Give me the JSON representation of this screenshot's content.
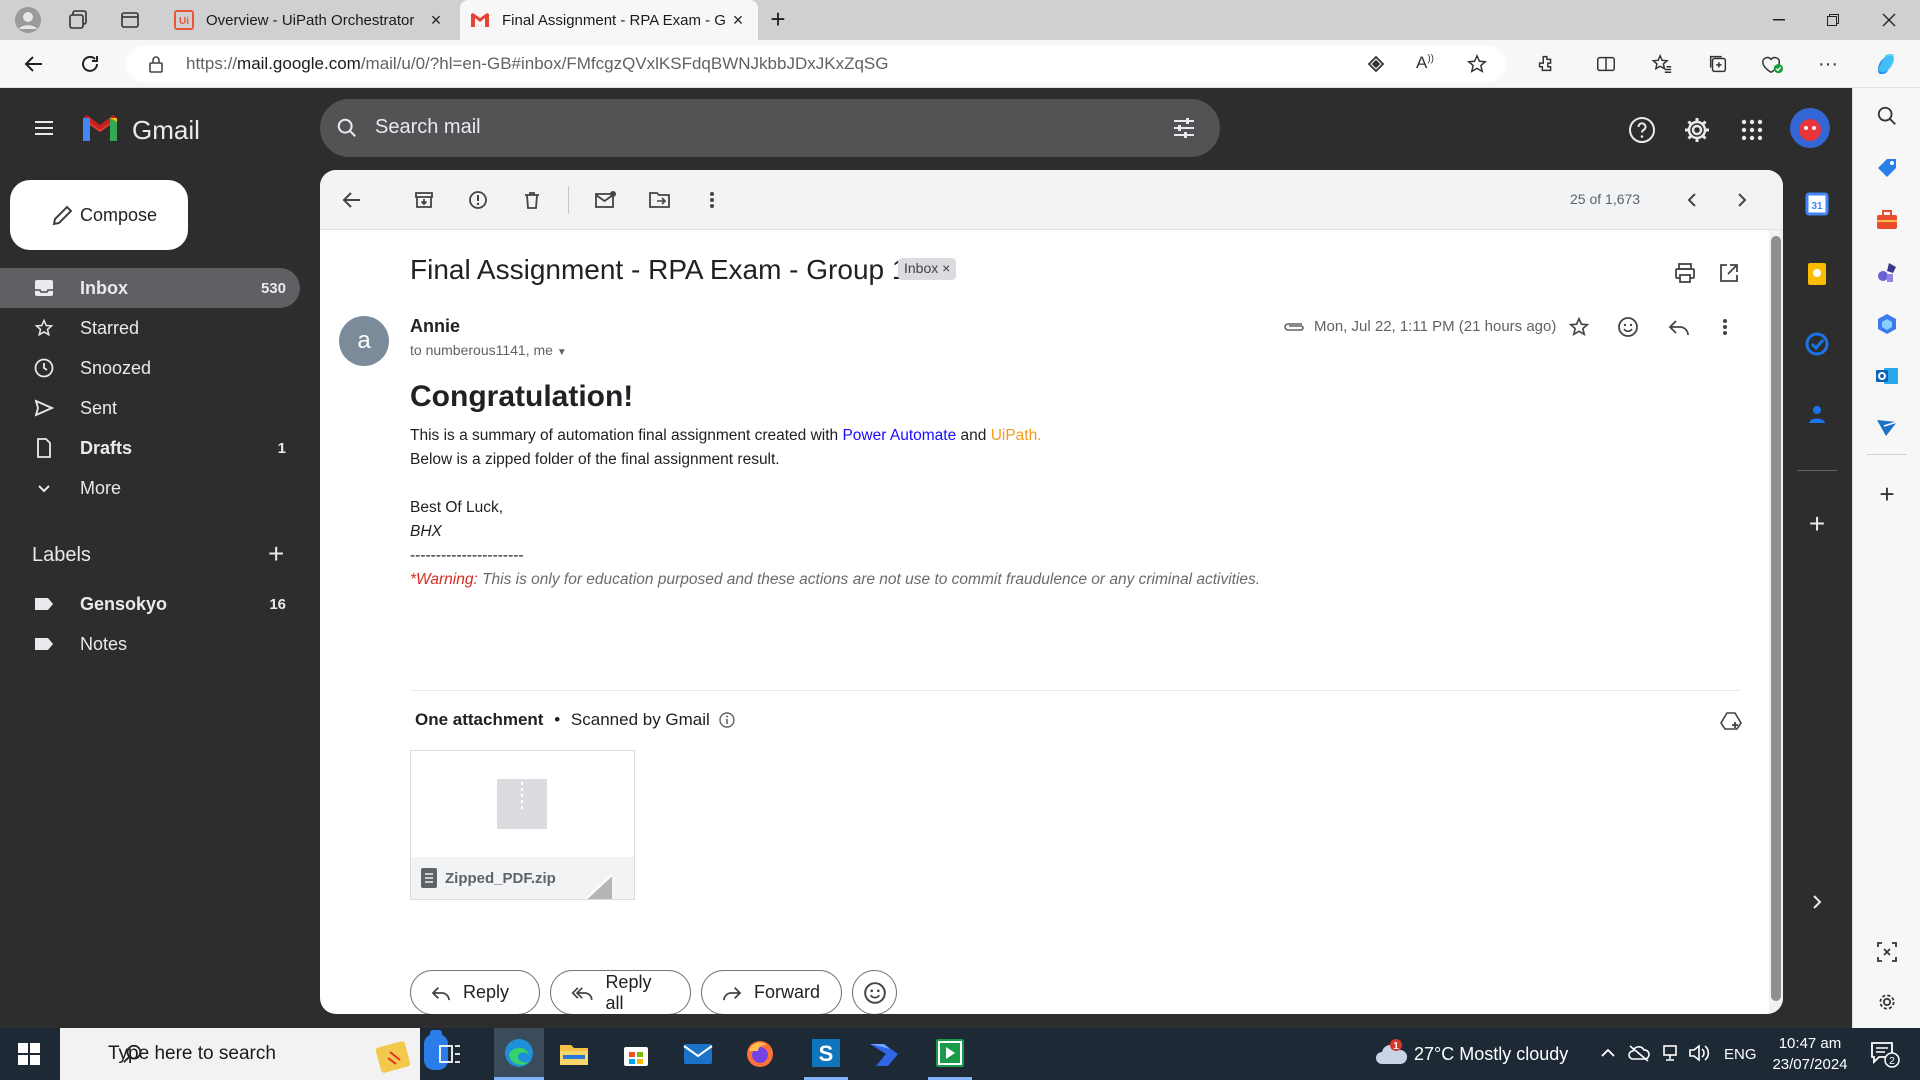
{
  "browser": {
    "tabs": [
      {
        "title": "Overview - UiPath Orchestrator",
        "favicon": "uipath-icon",
        "active": false
      },
      {
        "title": "Final Assignment - RPA Exam - G",
        "favicon": "gmail-icon",
        "active": true
      }
    ],
    "url_prefix": "https://",
    "url_host": "mail.google.com",
    "url_path": "/mail/u/0/?hl=en-GB#inbox/FMfcgzQVxlKSFdqBWNJkbbJDxJKxZqSG"
  },
  "gmail": {
    "brand": "Gmail",
    "search_placeholder": "Search mail",
    "compose_label": "Compose",
    "nav": [
      {
        "label": "Inbox",
        "count": "530",
        "icon": "inbox-icon",
        "active": true
      },
      {
        "label": "Starred",
        "count": "",
        "icon": "star-icon",
        "active": false
      },
      {
        "label": "Snoozed",
        "count": "",
        "icon": "clock-icon",
        "active": false
      },
      {
        "label": "Sent",
        "count": "",
        "icon": "send-icon",
        "active": false
      },
      {
        "label": "Drafts",
        "count": "1",
        "icon": "draft-icon",
        "active": false
      },
      {
        "label": "More",
        "count": "",
        "icon": "chevron-down-icon",
        "active": false
      }
    ],
    "labels_heading": "Labels",
    "labels": [
      {
        "label": "Gensokyo",
        "count": "16"
      },
      {
        "label": "Notes",
        "count": ""
      }
    ],
    "pagination": "25 of 1,673"
  },
  "message": {
    "subject": "Final Assignment - RPA Exam - Group 1",
    "chip": "Inbox",
    "avatar_letter": "a",
    "sender": "Annie",
    "recipients": "to numberous1141, me",
    "date": "Mon, Jul 22, 1:11 PM (21 hours ago)",
    "heading": "Congratulation!",
    "line1_before": "This is a summary of automation final assignment created with ",
    "line1_link1": "Power Automate",
    "line1_mid": " and ",
    "line1_link2": "UiPath",
    "line1_end": ".",
    "line2": "Below is a zipped folder of the final assignment result.",
    "closing": "Best Of Luck,",
    "signature": "BHX",
    "separator": "----------------------",
    "warning_label": "*Warning:",
    "warning_text": " This is only for education purposed and these actions are not use to commit fraudulence or any criminal activities.",
    "attachment_heading": "One attachment",
    "scanned": "Scanned by Gmail",
    "attachment_name": "Zipped_PDF.zip",
    "actions": {
      "reply": "Reply",
      "reply_all": "Reply all",
      "forward": "Forward"
    }
  },
  "taskbar": {
    "search_placeholder": "Type here to search",
    "weather": "27°C  Mostly cloudy",
    "weather_badge": "1",
    "language": "ENG",
    "time": "10:47 am",
    "date": "23/07/2024",
    "notifications": "2"
  },
  "colors": {
    "link_blue": "#1a0dff",
    "link_orange": "#f29a1c",
    "warning_red": "#d62d20",
    "gmail_bg": "#2d2d2d"
  }
}
